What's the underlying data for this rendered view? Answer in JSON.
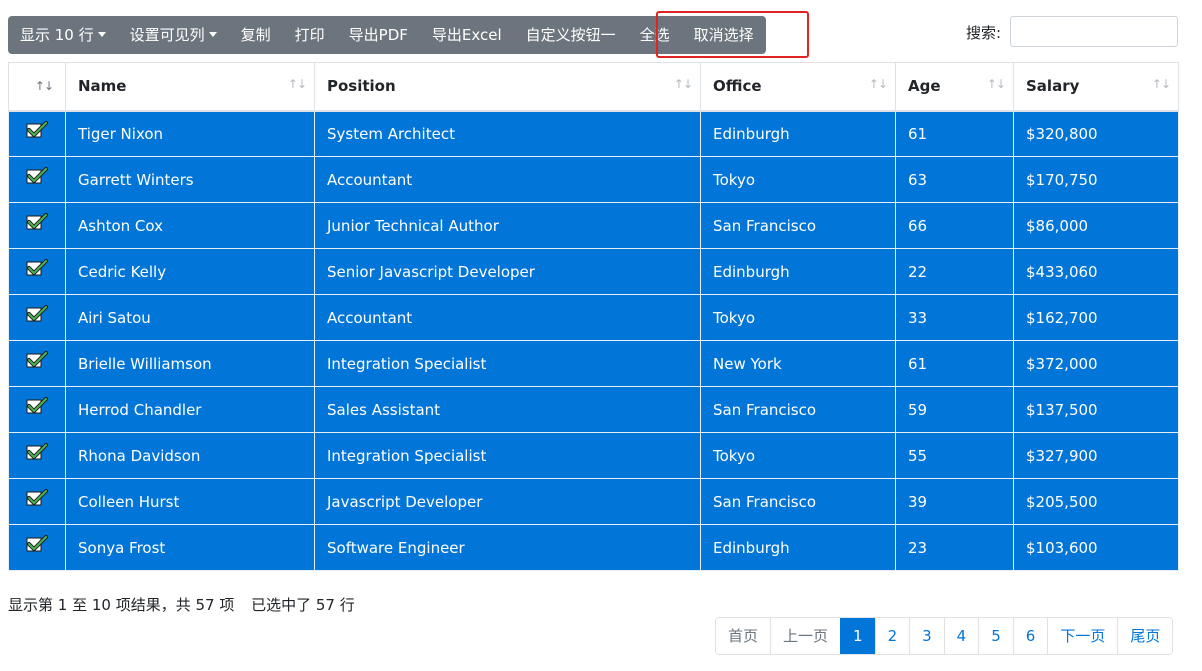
{
  "toolbar": {
    "buttons": [
      {
        "label": "显示 10 行",
        "dropdown": true
      },
      {
        "label": "设置可见列",
        "dropdown": true
      },
      {
        "label": "复制",
        "dropdown": false
      },
      {
        "label": "打印",
        "dropdown": false
      },
      {
        "label": "导出PDF",
        "dropdown": false
      },
      {
        "label": "导出Excel",
        "dropdown": false
      },
      {
        "label": "自定义按钮一",
        "dropdown": false
      },
      {
        "label": "全选",
        "dropdown": false
      },
      {
        "label": "取消选择",
        "dropdown": false
      }
    ]
  },
  "search": {
    "label": "搜索:",
    "value": ""
  },
  "table": {
    "sort_glyph": "↑↓",
    "columns": [
      "Name",
      "Position",
      "Office",
      "Age",
      "Salary"
    ],
    "rows": [
      [
        "Tiger Nixon",
        "System Architect",
        "Edinburgh",
        "61",
        "$320,800"
      ],
      [
        "Garrett Winters",
        "Accountant",
        "Tokyo",
        "63",
        "$170,750"
      ],
      [
        "Ashton Cox",
        "Junior Technical Author",
        "San Francisco",
        "66",
        "$86,000"
      ],
      [
        "Cedric Kelly",
        "Senior Javascript Developer",
        "Edinburgh",
        "22",
        "$433,060"
      ],
      [
        "Airi Satou",
        "Accountant",
        "Tokyo",
        "33",
        "$162,700"
      ],
      [
        "Brielle Williamson",
        "Integration Specialist",
        "New York",
        "61",
        "$372,000"
      ],
      [
        "Herrod Chandler",
        "Sales Assistant",
        "San Francisco",
        "59",
        "$137,500"
      ],
      [
        "Rhona Davidson",
        "Integration Specialist",
        "Tokyo",
        "55",
        "$327,900"
      ],
      [
        "Colleen Hurst",
        "Javascript Developer",
        "San Francisco",
        "39",
        "$205,500"
      ],
      [
        "Sonya Frost",
        "Software Engineer",
        "Edinburgh",
        "23",
        "$103,600"
      ]
    ],
    "selected_rows": 10,
    "row_selected_color": "#0275d8",
    "check_color": "#4caf50"
  },
  "footer": {
    "info": "显示第 1 至 10 项结果，共 57 项",
    "selected": "已选中了 57 行"
  },
  "pagination": {
    "items": [
      "首页",
      "上一页",
      "1",
      "2",
      "3",
      "4",
      "5",
      "6",
      "下一页",
      "尾页"
    ],
    "active": "1",
    "disabled": [
      "首页",
      "上一页"
    ]
  },
  "colors": {
    "toolbar_bg": "#6c757d",
    "accent": "#0275d8",
    "highlight_border": "#e02424"
  }
}
